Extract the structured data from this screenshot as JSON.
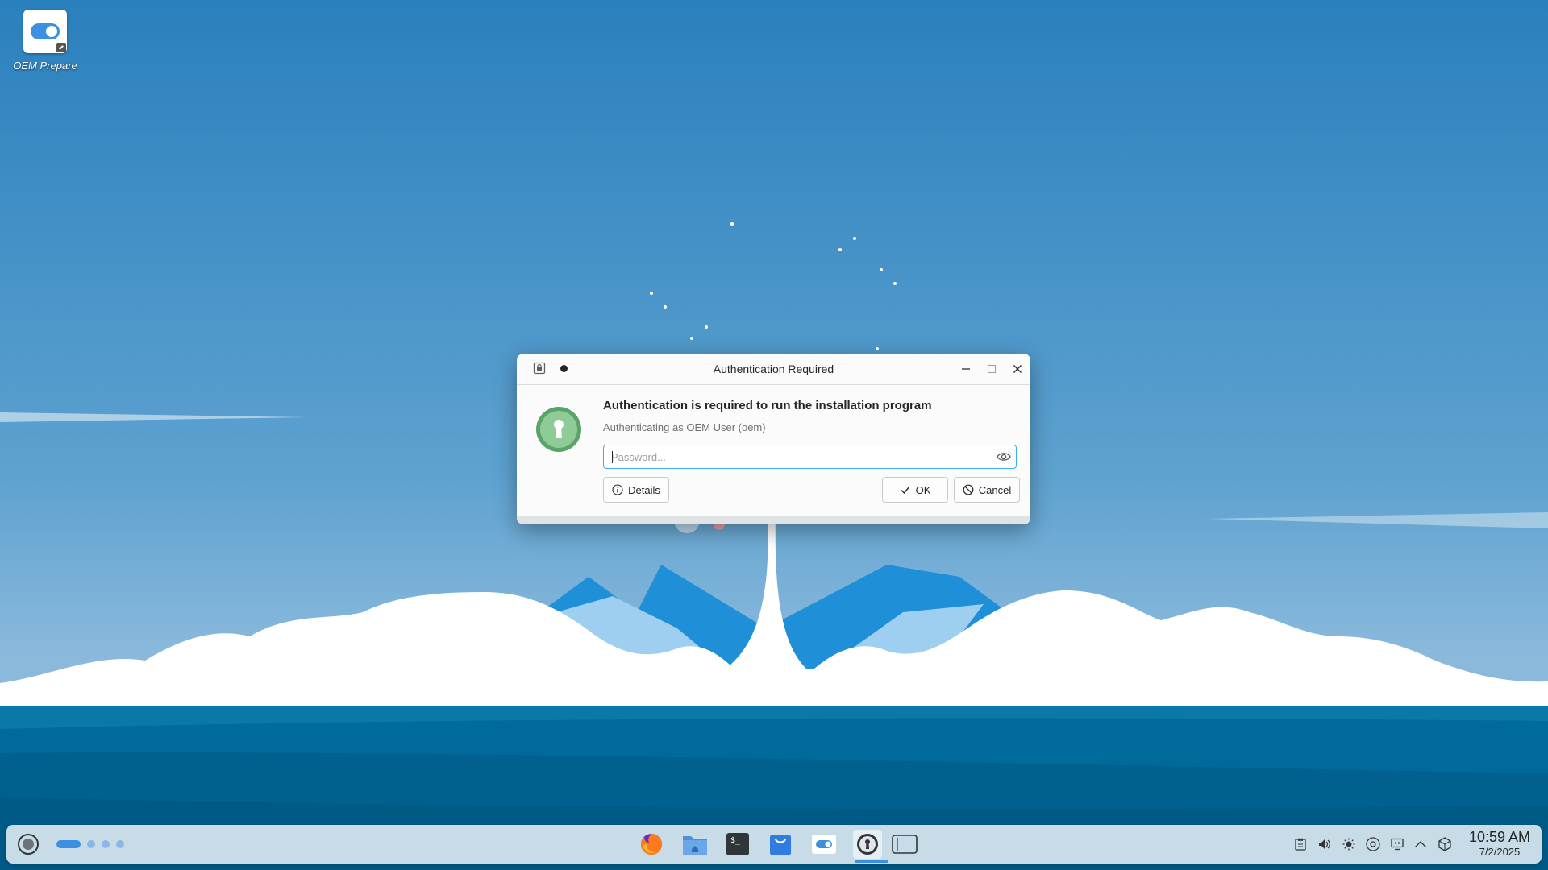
{
  "desktop": {
    "icons": [
      {
        "label": "OEM Prepare"
      }
    ]
  },
  "dialog": {
    "title": "Authentication Required",
    "heading": "Authentication is required to run the installation program",
    "subtext": "Authenticating as OEM User (oem)",
    "password": {
      "value": "",
      "placeholder": "Password..."
    },
    "buttons": {
      "details": "Details",
      "ok": "OK",
      "cancel": "Cancel"
    }
  },
  "taskbar": {
    "pager": {
      "desktops": 4,
      "active": 1
    },
    "tasks": [
      {
        "icon": "firefox-icon"
      },
      {
        "icon": "home-folder-icon"
      },
      {
        "icon": "terminal-icon",
        "glyph": "$_"
      },
      {
        "icon": "discover-store-icon"
      },
      {
        "icon": "oem-prepare-icon"
      },
      {
        "icon": "authentication-icon",
        "active": true
      },
      {
        "icon": "show-desktop-icon"
      }
    ],
    "tray": [
      "clipboard-icon",
      "volume-icon",
      "brightness-icon",
      "disk-icon",
      "display-icon",
      "expand-tray-icon",
      "network-icon"
    ],
    "clock": {
      "time": "10:59 AM",
      "date": "7/2/2025"
    }
  },
  "colors": {
    "accent": "#3daee9",
    "sky": "#2d86c4",
    "sea": "#00679a",
    "shield": "#7bbf86"
  }
}
